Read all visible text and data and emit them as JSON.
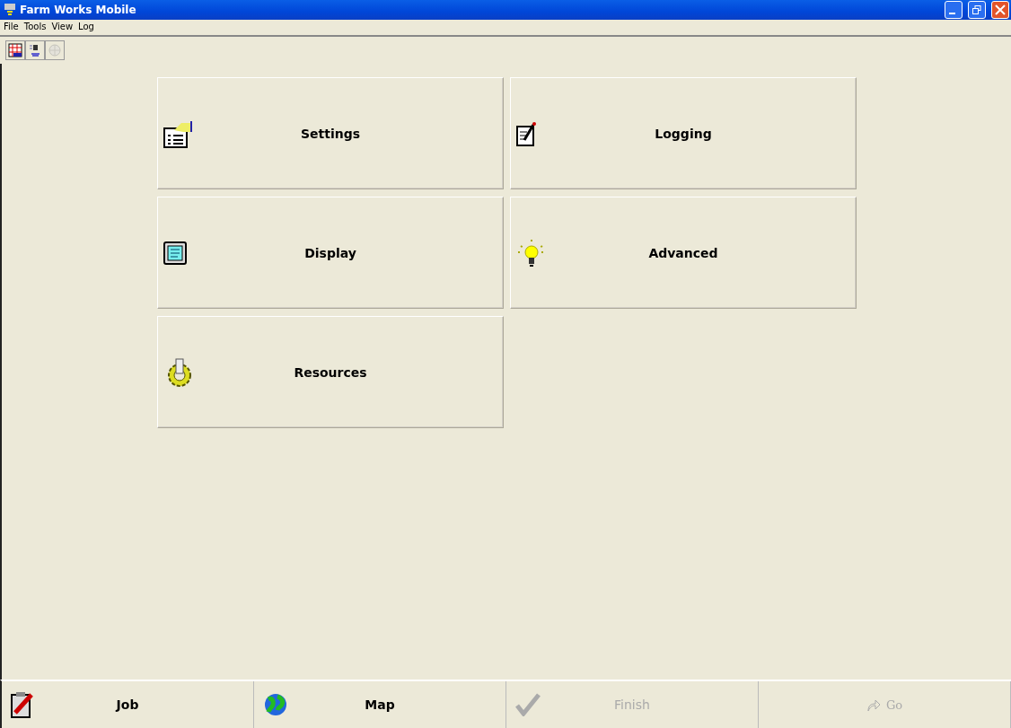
{
  "window": {
    "title": "Farm Works Mobile"
  },
  "menu": [
    "File",
    "Tools",
    "View",
    "Log"
  ],
  "toolbar": [
    {
      "kind": "grid",
      "disabled": false
    },
    {
      "kind": "receiver",
      "disabled": false
    },
    {
      "kind": "globe",
      "disabled": true
    }
  ],
  "tiles": [
    {
      "kind": "settings",
      "label": "Settings"
    },
    {
      "kind": "logging",
      "label": "Logging"
    },
    {
      "kind": "display",
      "label": "Display"
    },
    {
      "kind": "advanced",
      "label": "Advanced"
    },
    {
      "kind": "resources",
      "label": "Resources"
    }
  ],
  "bottom_buttons": [
    {
      "kind": "job",
      "label": "Job",
      "disabled": false
    },
    {
      "kind": "map",
      "label": "Map",
      "disabled": false
    },
    {
      "kind": "finish",
      "label": "Finish",
      "disabled": true
    },
    {
      "kind": "go",
      "label": "Go",
      "disabled": true
    }
  ]
}
